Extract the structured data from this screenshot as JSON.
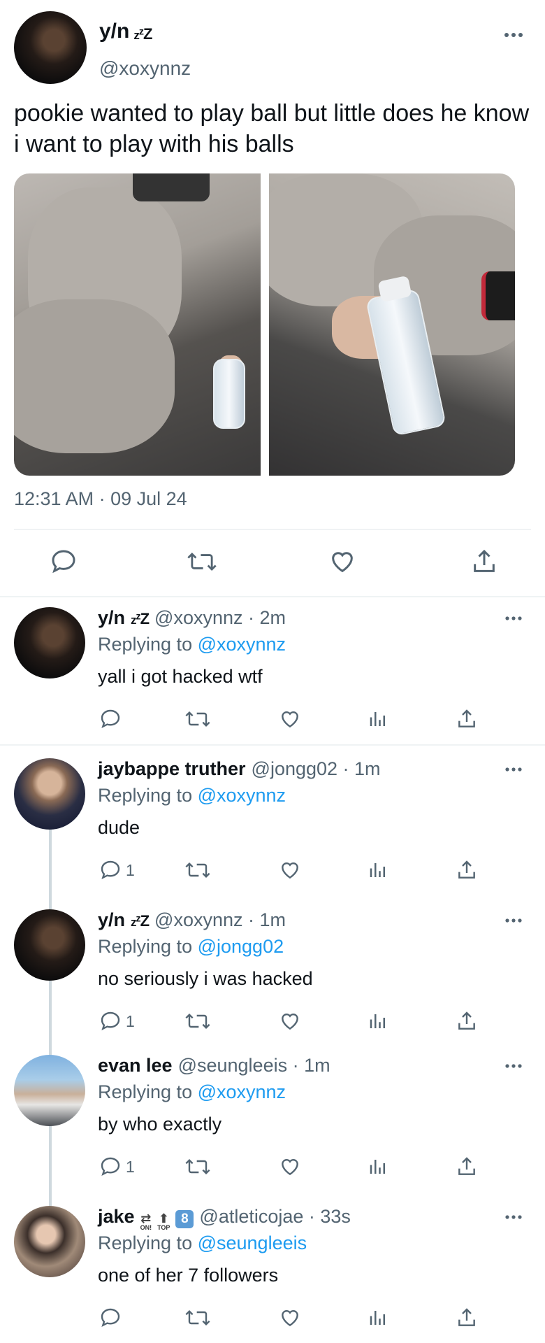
{
  "main_tweet": {
    "display_name": "y/n",
    "handle": "@xoxynnz",
    "text": "pookie wanted to play ball but little does he know i want to play with his balls",
    "timestamp": "12:31 AM · 09 Jul 24",
    "actions": [
      "reply-icon",
      "retweet-icon",
      "like-icon",
      "share-icon"
    ]
  },
  "replies": [
    {
      "display_name": "y/n",
      "handle_time": "@xoxynnz · 2m",
      "replying_prefix": "Replying to ",
      "replying_to": "@xoxynnz",
      "text": "yall i got hacked wtf",
      "reply_count": ""
    },
    {
      "display_name": "jaybappe truther",
      "handle_time": "@jongg02 · 1m",
      "replying_prefix": "Replying to ",
      "replying_to": "@xoxynnz",
      "text": "dude",
      "reply_count": "1"
    },
    {
      "display_name": "y/n",
      "handle_time": "@xoxynnz · 1m",
      "replying_prefix": "Replying to ",
      "replying_to": "@jongg02",
      "text": "no seriously i was hacked",
      "reply_count": "1"
    },
    {
      "display_name": "evan lee",
      "handle_time": "@seungleeis · 1m",
      "replying_prefix": "Replying to ",
      "replying_to": "@xoxynnz",
      "text": "by who exactly",
      "reply_count": "1"
    },
    {
      "display_name": "jake",
      "badge_on": "ON!",
      "badge_top": "TOP",
      "badge_num": "8",
      "handle_time": "@atleticojae · 33s",
      "replying_prefix": "Replying to ",
      "replying_to": "@seungleeis",
      "text": "one of her 7 followers",
      "reply_count": ""
    }
  ],
  "colors": {
    "link": "#1d9bf0",
    "muted": "#536471",
    "text": "#0f1419"
  }
}
